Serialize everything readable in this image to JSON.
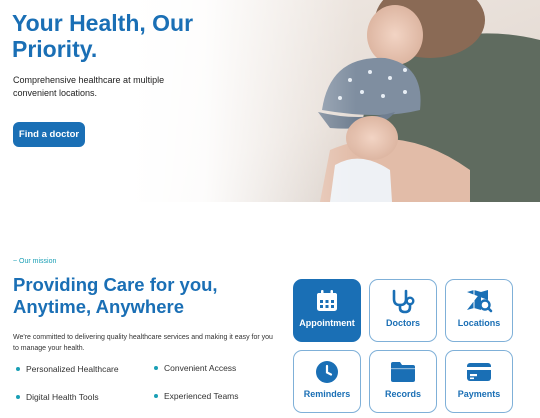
{
  "hero": {
    "title": "Your Health, Our Priority.",
    "subtitle": "Comprehensive healthcare at multiple convenient locations.",
    "cta_label": "Find a doctor"
  },
  "mission": {
    "eyebrow": "~ Our mission",
    "title": "Providing Care for you, Anytime, Anywhere",
    "description": "We're committed to delivering quality healthcare services and making it easy for you to manage your health.",
    "features": [
      "Personalized Healthcare",
      "Convenient Access",
      "Digital Health Tools",
      "Experienced Teams"
    ]
  },
  "services": [
    {
      "label": "Appointment",
      "icon": "calendar-icon",
      "active": true
    },
    {
      "label": "Doctors",
      "icon": "stethoscope-icon",
      "active": false
    },
    {
      "label": "Locations",
      "icon": "map-search-icon",
      "active": false
    },
    {
      "label": "Reminders",
      "icon": "clock-icon",
      "active": false
    },
    {
      "label": "Records",
      "icon": "folder-icon",
      "active": false
    },
    {
      "label": "Payments",
      "icon": "credit-card-icon",
      "active": false
    }
  ],
  "colors": {
    "primary": "#1a6fb5",
    "accent": "#1a9fb5",
    "tile_border": "#7fb0d8"
  }
}
